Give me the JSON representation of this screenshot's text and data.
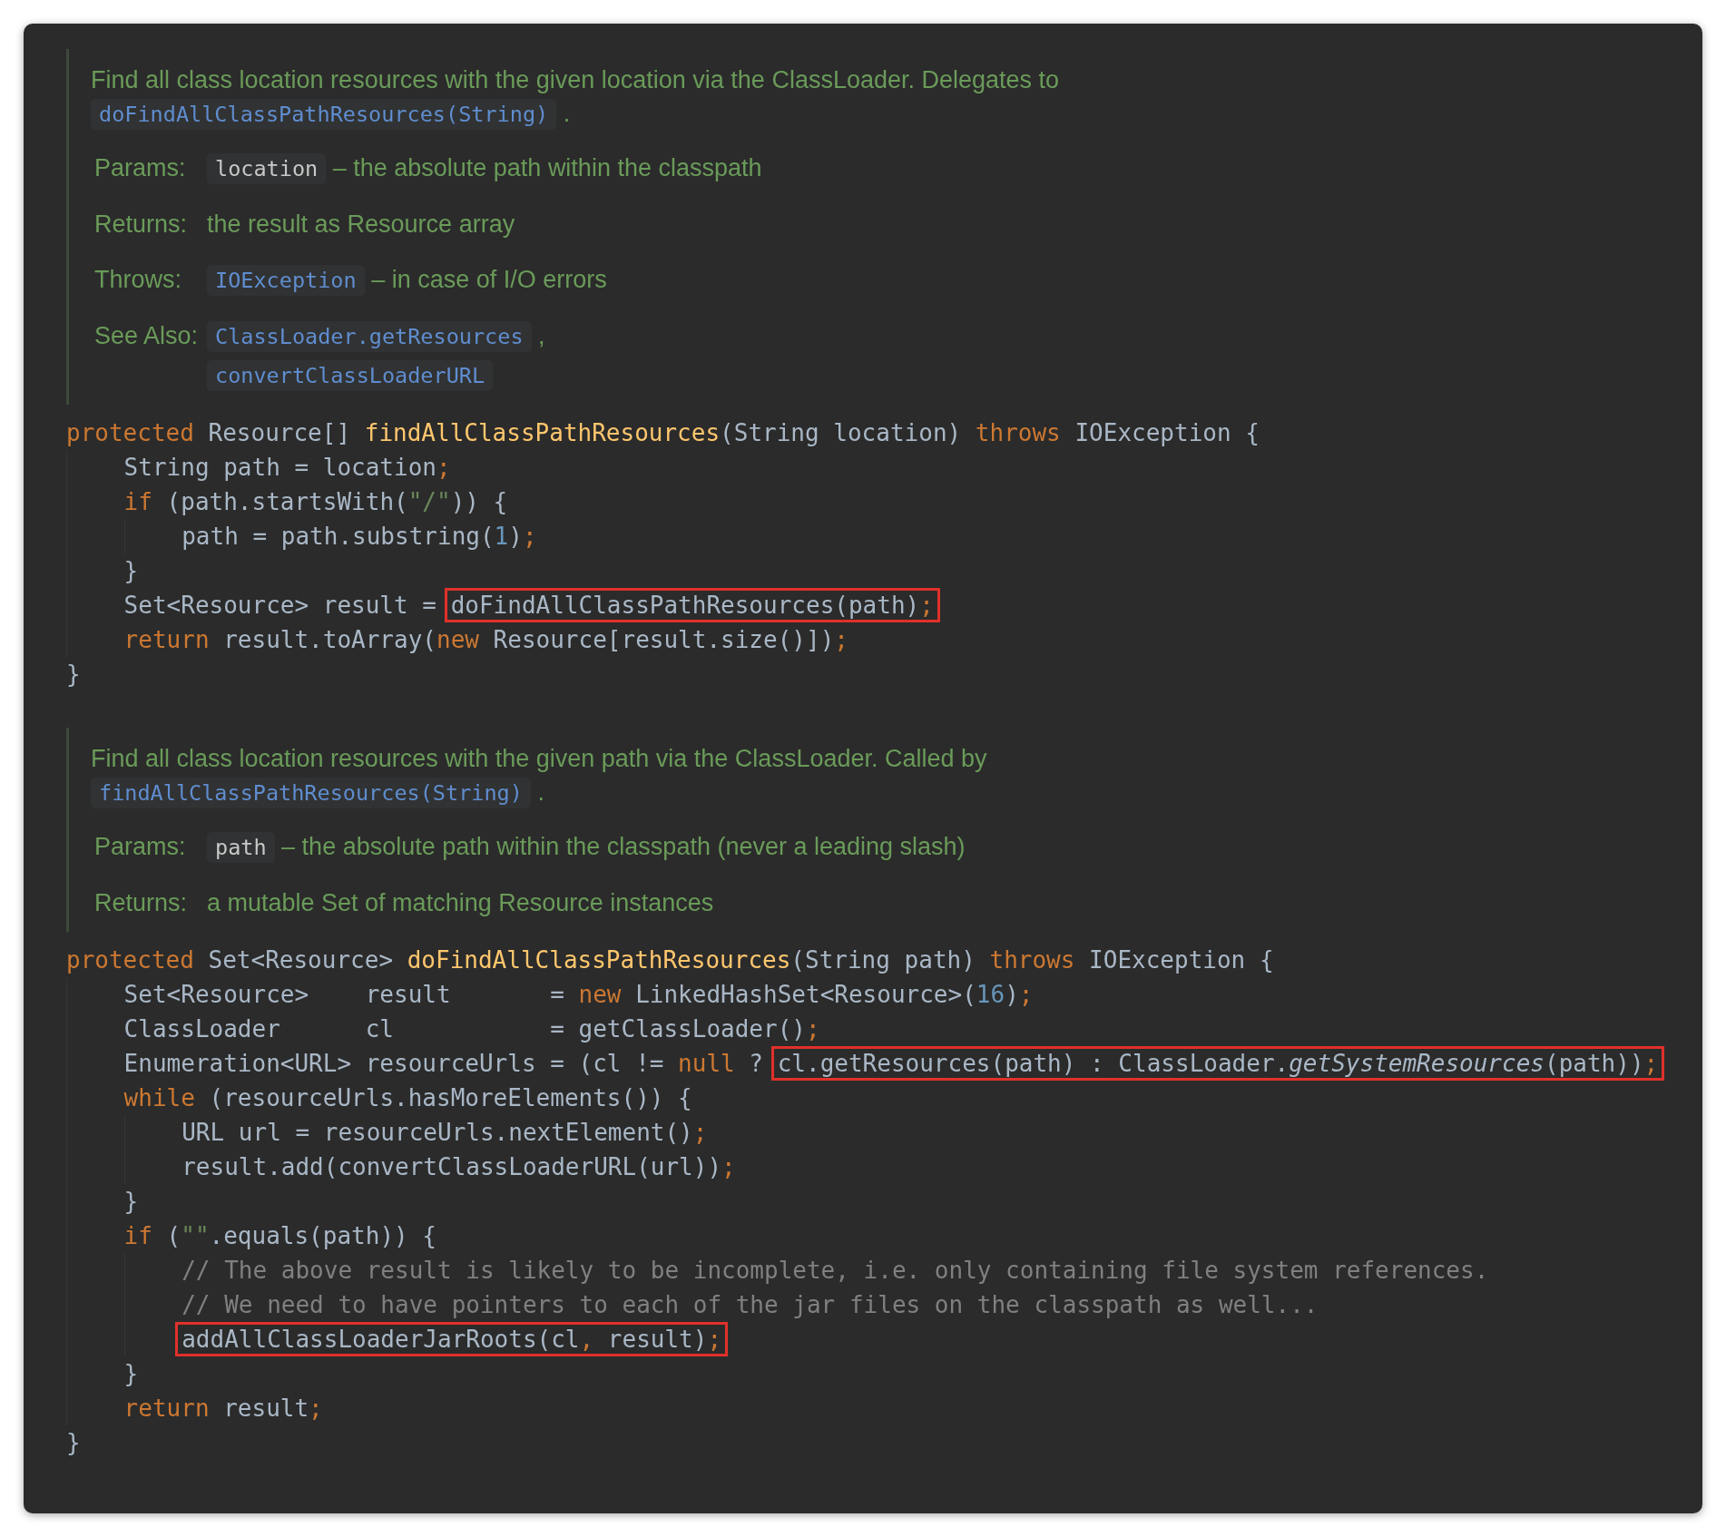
{
  "blocks": [
    {
      "kind": "doc",
      "summary": [
        {
          "kind": "text",
          "text": "Find all class location resources with the given location via the ClassLoader. Delegates to "
        },
        {
          "kind": "link",
          "text": "doFindAllClassPathResources(String)"
        },
        {
          "kind": "text",
          "text": " ."
        }
      ],
      "tags": [
        {
          "label": "Params:",
          "lines": [
            [
              {
                "kind": "code",
                "text": "location"
              },
              {
                "kind": "text",
                "text": " – the absolute path within the classpath"
              }
            ]
          ]
        },
        {
          "label": "Returns:",
          "lines": [
            [
              {
                "kind": "text",
                "text": "the result as Resource array"
              }
            ]
          ]
        },
        {
          "label": "Throws:",
          "lines": [
            [
              {
                "kind": "link",
                "text": "IOException"
              },
              {
                "kind": "text",
                "text": " – in case of I/O errors"
              }
            ]
          ]
        },
        {
          "label": "See Also:",
          "lines": [
            [
              {
                "kind": "link",
                "text": "ClassLoader.getResources"
              },
              {
                "kind": "text",
                "text": " ,"
              }
            ],
            [
              {
                "kind": "link",
                "text": "convertClassLoaderURL"
              }
            ]
          ]
        }
      ]
    },
    {
      "kind": "code",
      "lines": [
        {
          "parts": [
            {
              "kind": "keyword",
              "text": "protected"
            },
            {
              "kind": "plain",
              "text": " Resource[] "
            },
            {
              "kind": "decl",
              "text": "findAllClassPathResources"
            },
            {
              "kind": "plain",
              "text": "(String location) "
            },
            {
              "kind": "keyword",
              "text": "throws"
            },
            {
              "kind": "plain",
              "text": " IOException {"
            }
          ],
          "children": [
            {
              "parts": [
                {
                  "kind": "plain",
                  "text": "String path = location"
                },
                {
                  "kind": "punct",
                  "text": ";"
                }
              ]
            },
            {
              "parts": [
                {
                  "kind": "keyword",
                  "text": "if"
                },
                {
                  "kind": "plain",
                  "text": " (path.startsWith("
                },
                {
                  "kind": "string",
                  "text": "\"/\""
                },
                {
                  "kind": "plain",
                  "text": ")) {"
                }
              ],
              "children": [
                {
                  "parts": [
                    {
                      "kind": "plain",
                      "text": "path = path.substring("
                    },
                    {
                      "kind": "number",
                      "text": "1"
                    },
                    {
                      "kind": "plain",
                      "text": ")"
                    },
                    {
                      "kind": "punct",
                      "text": ";"
                    }
                  ]
                }
              ]
            },
            {
              "parts": [
                {
                  "kind": "plain",
                  "text": "}"
                }
              ]
            },
            {
              "parts": [
                {
                  "kind": "plain",
                  "text": "Set<Resource> result = "
                },
                {
                  "kind": "boxed",
                  "tokens": [
                    {
                      "kind": "plain",
                      "text": "doFindAllClassPathResources(path)"
                    },
                    {
                      "kind": "punct",
                      "text": ";"
                    }
                  ]
                }
              ]
            },
            {
              "parts": [
                {
                  "kind": "keyword",
                  "text": "return"
                },
                {
                  "kind": "plain",
                  "text": " result.toArray("
                },
                {
                  "kind": "keyword",
                  "text": "new"
                },
                {
                  "kind": "plain",
                  "text": " Resource[result.size()])"
                },
                {
                  "kind": "punct",
                  "text": ";"
                }
              ]
            }
          ]
        },
        {
          "parts": [
            {
              "kind": "plain",
              "text": "}"
            }
          ]
        }
      ]
    },
    {
      "kind": "doc",
      "summary": [
        {
          "kind": "text",
          "text": "Find all class location resources with the given path via the ClassLoader. Called by "
        },
        {
          "kind": "link",
          "text": "findAllClassPathResources(String)"
        },
        {
          "kind": "text",
          "text": " ."
        }
      ],
      "tags": [
        {
          "label": "Params:",
          "lines": [
            [
              {
                "kind": "code",
                "text": "path"
              },
              {
                "kind": "text",
                "text": " – the absolute path within the classpath (never a leading slash)"
              }
            ]
          ]
        },
        {
          "label": "Returns:",
          "lines": [
            [
              {
                "kind": "text",
                "text": "a mutable Set of matching Resource instances"
              }
            ]
          ]
        }
      ]
    },
    {
      "kind": "code",
      "lines": [
        {
          "parts": [
            {
              "kind": "keyword",
              "text": "protected"
            },
            {
              "kind": "plain",
              "text": " Set<Resource> "
            },
            {
              "kind": "decl",
              "text": "doFindAllClassPathResources"
            },
            {
              "kind": "plain",
              "text": "(String path) "
            },
            {
              "kind": "keyword",
              "text": "throws"
            },
            {
              "kind": "plain",
              "text": " IOException {"
            }
          ],
          "children": [
            {
              "parts": [
                {
                  "kind": "plain",
                  "text": "Set<Resource>    result       = "
                },
                {
                  "kind": "keyword",
                  "text": "new"
                },
                {
                  "kind": "plain",
                  "text": " LinkedHashSet<Resource>("
                },
                {
                  "kind": "number",
                  "text": "16"
                },
                {
                  "kind": "plain",
                  "text": ")"
                },
                {
                  "kind": "punct",
                  "text": ";"
                }
              ]
            },
            {
              "parts": [
                {
                  "kind": "plain",
                  "text": "ClassLoader      cl           = getClassLoader()"
                },
                {
                  "kind": "punct",
                  "text": ";"
                }
              ]
            },
            {
              "parts": [
                {
                  "kind": "plain",
                  "text": "Enumeration<URL> resourceUrls = (cl != "
                },
                {
                  "kind": "keyword",
                  "text": "null"
                },
                {
                  "kind": "plain",
                  "text": " ? "
                },
                {
                  "kind": "boxed",
                  "tokens": [
                    {
                      "kind": "plain",
                      "text": "cl.getResources(path) : ClassLoader."
                    },
                    {
                      "kind": "static",
                      "text": "getSystemResources"
                    },
                    {
                      "kind": "plain",
                      "text": "(path))"
                    },
                    {
                      "kind": "punct",
                      "text": ";"
                    }
                  ]
                }
              ]
            },
            {
              "parts": [
                {
                  "kind": "keyword",
                  "text": "while"
                },
                {
                  "kind": "plain",
                  "text": " (resourceUrls.hasMoreElements()) {"
                }
              ],
              "children": [
                {
                  "parts": [
                    {
                      "kind": "plain",
                      "text": "URL url = resourceUrls.nextElement()"
                    },
                    {
                      "kind": "punct",
                      "text": ";"
                    }
                  ]
                },
                {
                  "parts": [
                    {
                      "kind": "plain",
                      "text": "result.add(convertClassLoaderURL(url))"
                    },
                    {
                      "kind": "punct",
                      "text": ";"
                    }
                  ]
                }
              ]
            },
            {
              "parts": [
                {
                  "kind": "plain",
                  "text": "}"
                }
              ]
            },
            {
              "parts": [
                {
                  "kind": "keyword",
                  "text": "if"
                },
                {
                  "kind": "plain",
                  "text": " ("
                },
                {
                  "kind": "string",
                  "text": "\"\""
                },
                {
                  "kind": "plain",
                  "text": ".equals(path)) {"
                }
              ],
              "children": [
                {
                  "parts": [
                    {
                      "kind": "comment",
                      "text": "// The above result is likely to be incomplete, i.e. only containing file system references."
                    }
                  ]
                },
                {
                  "parts": [
                    {
                      "kind": "comment",
                      "text": "// We need to have pointers to each of the jar files on the classpath as well..."
                    }
                  ]
                },
                {
                  "parts": [
                    {
                      "kind": "boxed",
                      "tokens": [
                        {
                          "kind": "plain",
                          "text": "addAllClassLoaderJarRoots(cl"
                        },
                        {
                          "kind": "punct",
                          "text": ","
                        },
                        {
                          "kind": "plain",
                          "text": " result)"
                        },
                        {
                          "kind": "punct",
                          "text": ";"
                        }
                      ]
                    }
                  ]
                }
              ]
            },
            {
              "parts": [
                {
                  "kind": "plain",
                  "text": "}"
                }
              ]
            },
            {
              "parts": [
                {
                  "kind": "keyword",
                  "text": "return"
                },
                {
                  "kind": "plain",
                  "text": " result"
                },
                {
                  "kind": "punct",
                  "text": ";"
                }
              ]
            }
          ]
        },
        {
          "parts": [
            {
              "kind": "plain",
              "text": "}"
            }
          ]
        }
      ]
    }
  ]
}
